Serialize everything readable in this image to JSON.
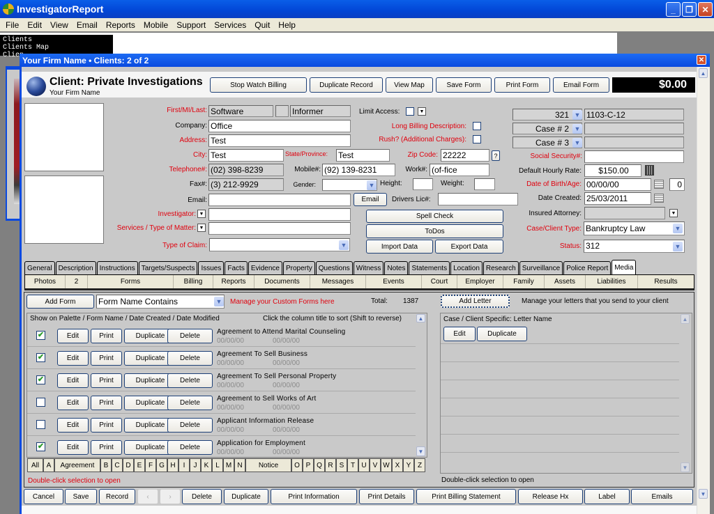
{
  "app": {
    "title": "InvestigatorReport",
    "menu": [
      "File",
      "Edit",
      "View",
      "Email",
      "Reports",
      "Mobile",
      "Support",
      "Services",
      "Quit",
      "Help"
    ],
    "window_controls": {
      "minimize": "_",
      "restore": "❐",
      "close": "✕"
    }
  },
  "background_window": {
    "menu_lines": [
      "Clients",
      "Clients Map",
      "Clien",
      "("
    ]
  },
  "child_window": {
    "title": "Your Firm Name  •  Clients: 2 of 2",
    "close": "✕"
  },
  "header": {
    "client_title": "Client:  Private Investigations",
    "firm_name": "Your Firm Name",
    "buttons": [
      "Stop Watch Billing",
      "Duplicate Record",
      "View Map",
      "Save Form",
      "Print Form",
      "Email Form"
    ],
    "balance": "$0.00"
  },
  "form": {
    "first_mi_last_label": "First/MI/Last:",
    "first_name": "Software",
    "middle_initial": "",
    "last_name": "Informer",
    "company_label": "Company:",
    "company": "Office",
    "address_label": "Address:",
    "address": "Test",
    "city_label": "City:",
    "city": "Test",
    "state_label": "State/Province:",
    "state": "Test",
    "zip_label": "Zip Code:",
    "zip": "22222",
    "zip_help": "?",
    "telephone_label": "Telephone#:",
    "telephone": "(02) 398-8239",
    "mobile_label": "Mobile#:",
    "mobile": "(92) 139-8231",
    "work_label": "Work#:",
    "work": "(of-fice",
    "fax_label": "Fax#:",
    "fax": "(3) 212-9929",
    "gender_label": "Gender:",
    "gender": "",
    "height_label": "Height:",
    "height": "",
    "weight_label": "Weight:",
    "weight": "",
    "email_label": "Email:",
    "email": "",
    "email_button": "Email",
    "drivers_lic_label": "Drivers Lic#:",
    "drivers_lic": "",
    "investigator_label": "Investigator:",
    "investigator": "",
    "services_label": "Services / Type of Matter:",
    "services": "",
    "claim_label": "Type of Claim:",
    "claim": "",
    "limit_access_label": "Limit Access:",
    "long_billing_label": "Long Billing Description:",
    "rush_label": "Rush? (Additional Charges):",
    "spell_check": "Spell Check",
    "todos": "ToDos",
    "import_data": "Import Data",
    "export_data": "Export Data"
  },
  "case": {
    "case1_select": "321",
    "case1_value": "1103-C-12",
    "case2_select": "Case # 2",
    "case2_value": "",
    "case3_select": "Case # 3",
    "case3_value": "",
    "ssn_label": "Social Security#:",
    "ssn": "",
    "rate_label": "Default Hourly Rate:",
    "rate": "$150.00",
    "dob_label": "Date of Birth/Age:",
    "dob": "00/00/00",
    "age": "0",
    "created_label": "Date Created:",
    "created": "25/03/2011",
    "attorney_label": "Insured Attorney:",
    "attorney": "",
    "type_label": "Case/Client Type:",
    "type": "Bankruptcy Law",
    "status_label": "Status:",
    "status": "312"
  },
  "tabs": [
    "General",
    "Description",
    "Instructions",
    "Targets/Suspects",
    "Issues",
    "Facts",
    "Evidence",
    "Property",
    "Questions",
    "Witness",
    "Notes",
    "Statements",
    "Location",
    "Research",
    "Surveillance",
    "Police Report",
    "Media"
  ],
  "active_tab": "Media",
  "subtabs": [
    "Photos",
    "2",
    "Forms",
    "Billing",
    "Reports",
    "Documents",
    "Messages",
    "Events",
    "Court",
    "Employer",
    "Family",
    "Assets",
    "Liabilities",
    "Results"
  ],
  "forms_panel": {
    "add_form": "Add Form",
    "filter": "Form Name Contains",
    "manage_text": "Manage your Custom Forms here",
    "total_label": "Total:",
    "total": "1387",
    "header_left": "Show on Palette / Form Name  /  Date Created  /  Date Modified",
    "header_right": "Click the column title to sort   (Shift to reverse)",
    "row_buttons": [
      "Edit",
      "Print",
      "Duplicate",
      "Delete"
    ],
    "rows": [
      {
        "checked": true,
        "name": "Agreement to Attend Marital Counseling",
        "created": "00/00/00",
        "modified": "00/00/00"
      },
      {
        "checked": true,
        "name": "Agreement To Sell Business",
        "created": "00/00/00",
        "modified": "00/00/00"
      },
      {
        "checked": true,
        "name": "Agreement To Sell Personal Property",
        "created": "00/00/00",
        "modified": "00/00/00"
      },
      {
        "checked": false,
        "name": "Agreement to Sell Works of Art",
        "created": "00/00/00",
        "modified": "00/00/00"
      },
      {
        "checked": false,
        "name": "Applicant Information Release",
        "created": "00/00/00",
        "modified": "00/00/00"
      },
      {
        "checked": true,
        "name": "Application for Employment",
        "created": "00/00/00",
        "modified": "00/00/00"
      }
    ],
    "alpha": [
      "All",
      "A",
      "Agreement",
      "B",
      "C",
      "D",
      "E",
      "F",
      "G",
      "H",
      "I",
      "J",
      "K",
      "L",
      "M",
      "N",
      "Notice",
      "O",
      "P",
      "Q",
      "R",
      "S",
      "T",
      "U",
      "V",
      "W",
      "X",
      "Y",
      "Z"
    ],
    "footer": "Double-click selection to open"
  },
  "letters_panel": {
    "add_letter": "Add Letter",
    "manage_text": "Manage your letters that you send to your client",
    "header": "Case / Client Specific:  Letter Name",
    "edit": "Edit",
    "duplicate": "Duplicate",
    "footer": "Double-click selection to open"
  },
  "bottom_buttons": [
    "Cancel",
    "Save",
    "Record",
    "‹",
    "›",
    "Delete",
    "Duplicate",
    "Print Information",
    "Print Details",
    "Print Billing Statement",
    "Release Hx",
    "Label",
    "Emails"
  ]
}
